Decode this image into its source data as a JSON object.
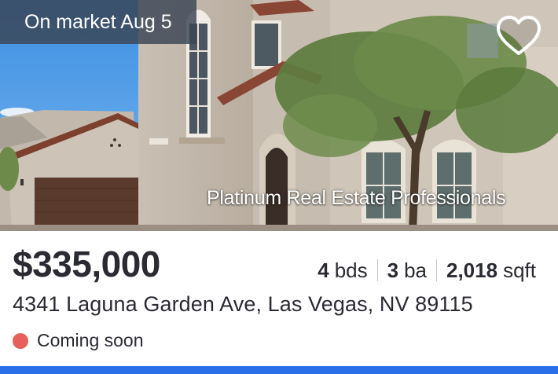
{
  "listing": {
    "market_badge": "On market Aug 5",
    "watermark": "Platinum Real Estate Professionals",
    "price": "$335,000",
    "beds_value": "4",
    "beds_unit": "bds",
    "baths_value": "3",
    "baths_unit": "ba",
    "sqft_value": "2,018",
    "sqft_unit": "sqft",
    "address": "4341 Laguna Garden Ave, Las Vegas, NV 89115",
    "status_label": "Coming soon"
  },
  "icons": {
    "favorite": "heart-outline-icon",
    "status": "status-dot-icon"
  },
  "colors": {
    "status_dot": "#e8605a",
    "accent_bar": "#2a6ee8",
    "badge_bg": "#3a4454",
    "text": "#2a2a33"
  }
}
